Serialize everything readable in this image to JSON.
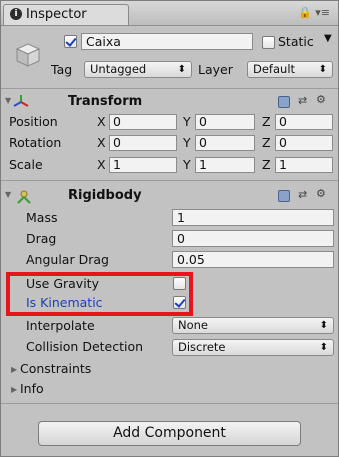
{
  "tab": {
    "title": "Inspector",
    "icons": "🔒 ▾≡"
  },
  "object": {
    "name": "Caixa",
    "static_label": "Static",
    "tag_label": "Tag",
    "tag_value": "Untagged",
    "layer_label": "Layer",
    "layer_value": "Default"
  },
  "transform": {
    "title": "Transform",
    "rows": [
      {
        "label": "Position",
        "x": "0",
        "y": "0",
        "z": "0"
      },
      {
        "label": "Rotation",
        "x": "0",
        "y": "0",
        "z": "0"
      },
      {
        "label": "Scale",
        "x": "1",
        "y": "1",
        "z": "1"
      }
    ],
    "axes": {
      "x": "X",
      "y": "Y",
      "z": "Z"
    }
  },
  "rigidbody": {
    "title": "Rigidbody",
    "mass_label": "Mass",
    "mass": "1",
    "drag_label": "Drag",
    "drag": "0",
    "angular_drag_label": "Angular Drag",
    "angular_drag": "0.05",
    "use_gravity_label": "Use Gravity",
    "use_gravity": false,
    "is_kinematic_label": "Is Kinematic",
    "is_kinematic": true,
    "interpolate_label": "Interpolate",
    "interpolate": "None",
    "collision_label": "Collision Detection",
    "collision": "Discrete",
    "constraints_label": "Constraints",
    "info_label": "Info"
  },
  "add_component": "Add Component",
  "colors": {
    "highlight": "#e8141b",
    "kinematic_text": "#1d3fbf"
  }
}
